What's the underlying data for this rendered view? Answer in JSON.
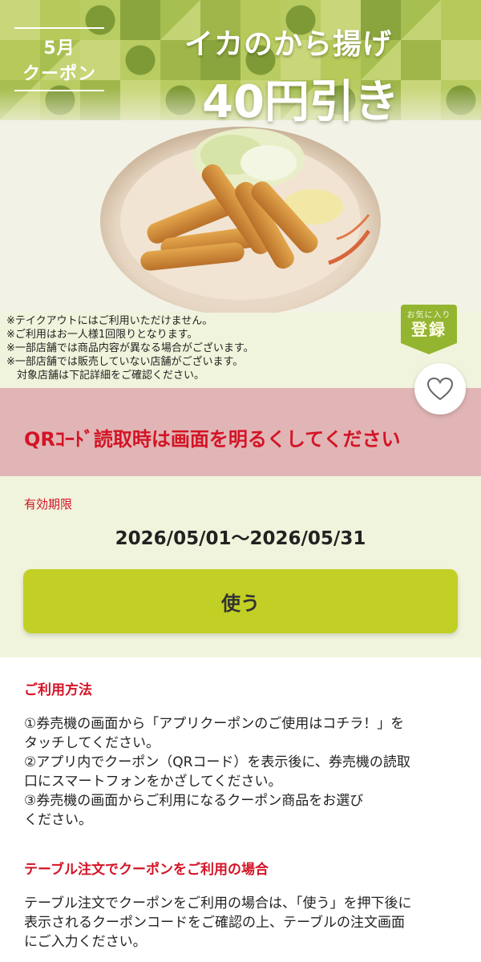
{
  "banner": {
    "month_label": "5月",
    "coupon_label": "クーポン",
    "product_name": "イカのから揚げ",
    "discount": "40円引き"
  },
  "notes": [
    "※テイクアウトにはご利用いただけません。",
    "※ご利用はお一人様1回限りとなります。",
    "※一部店舗では商品内容が異なる場合がございます。",
    "※一部店舗では販売していない店舗がございます。",
    "　対象店舗は下記詳細をご確認ください。"
  ],
  "favorite": {
    "small_label": "お気に入り",
    "big_label": "登録"
  },
  "warning": {
    "text": "QRｺｰﾄﾞ読取時は画面を明るくしてください"
  },
  "validity": {
    "label": "有効期限",
    "range": "2026/05/01～2026/05/31"
  },
  "use_button": {
    "label": "使う"
  },
  "how_to_use": {
    "title": "ご利用方法",
    "lines": [
      "①券売機の画面から「アプリクーポンのご使用はコチラ！」を",
      "タッチしてください。",
      "②アプリ内でクーポン（QRコード）を表示後に、券売機の読取",
      "口にスマートフォンをかざしてください。",
      "③券売機の画面からご利用になるクーポン商品をお選び",
      "ください。"
    ]
  },
  "table_order": {
    "title": "テーブル注文でクーポンをご利用の場合",
    "lines": [
      "テーブル注文でクーポンをご利用の場合は、「使う」を押下後に",
      "表示されるクーポンコードをご確認の上、テーブルの注文画面",
      "にご入力ください。"
    ]
  },
  "colors": {
    "accent_red": "#d31426",
    "button_green": "#c2cf25",
    "panel_green": "#f1f4dc",
    "warning_pink": "#e1b5b5"
  }
}
